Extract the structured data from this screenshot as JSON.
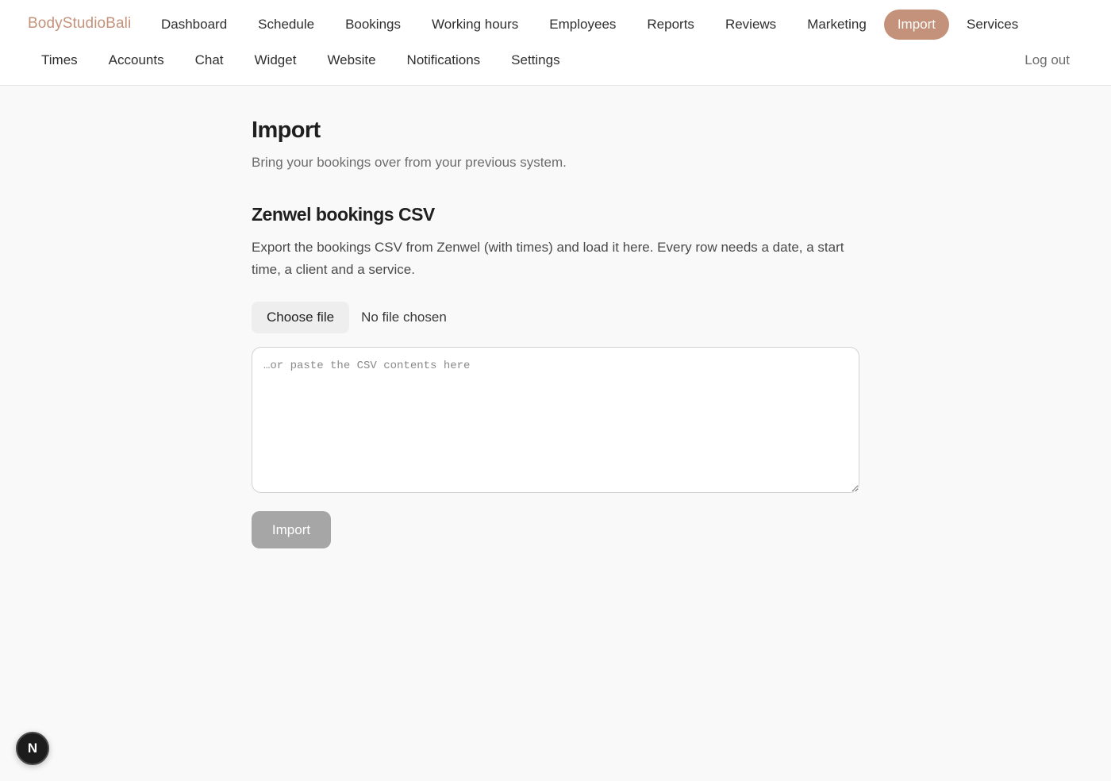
{
  "brand": "BodyStudioBali",
  "nav": {
    "row1": [
      {
        "label": "Dashboard",
        "active": false
      },
      {
        "label": "Schedule",
        "active": false
      },
      {
        "label": "Bookings",
        "active": false
      },
      {
        "label": "Working hours",
        "active": false
      },
      {
        "label": "Employees",
        "active": false
      },
      {
        "label": "Reports",
        "active": false
      },
      {
        "label": "Reviews",
        "active": false
      },
      {
        "label": "Marketing",
        "active": false
      },
      {
        "label": "Import",
        "active": true
      },
      {
        "label": "Services",
        "active": false
      }
    ],
    "row2": [
      {
        "label": "Times",
        "active": false
      },
      {
        "label": "Accounts",
        "active": false
      },
      {
        "label": "Chat",
        "active": false
      },
      {
        "label": "Widget",
        "active": false
      },
      {
        "label": "Website",
        "active": false
      },
      {
        "label": "Notifications",
        "active": false
      },
      {
        "label": "Settings",
        "active": false
      }
    ],
    "logout": "Log out"
  },
  "page": {
    "title": "Import",
    "subtitle": "Bring your bookings over from your previous system."
  },
  "section": {
    "title": "Zenwel bookings CSV",
    "description": "Export the bookings CSV from Zenwel (with times) and load it here. Every row needs a date, a start time, a client and a service.",
    "choose_file_label": "Choose file",
    "file_status": "No file chosen",
    "textarea_placeholder": "…or paste the CSV contents here",
    "textarea_value": "",
    "import_button_label": "Import"
  },
  "dev_badge": "N",
  "colors": {
    "accent": "#c4927a",
    "background": "#f9f9f9",
    "disabled_button": "#a6a6a6"
  }
}
